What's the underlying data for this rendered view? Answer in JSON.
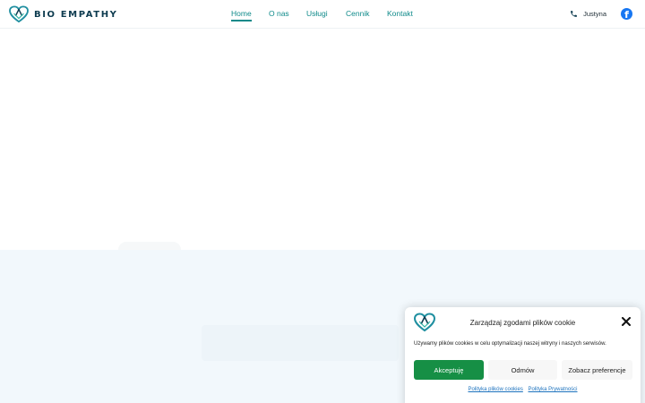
{
  "header": {
    "logo_text": "BIO EMPATHY",
    "nav": [
      {
        "label": "Home",
        "active": true
      },
      {
        "label": "O nas",
        "active": false
      },
      {
        "label": "Usługi",
        "active": false
      },
      {
        "label": "Cennik",
        "active": false
      },
      {
        "label": "Kontakt",
        "active": false
      }
    ],
    "phone_label": "Justyna",
    "facebook_icon": "facebook-icon"
  },
  "cookie_banner": {
    "title": "Zarządzaj zgodami plików cookie",
    "message": "Używamy plików cookies w celu optymalizacji naszej witryny i naszych serwisów.",
    "accept_label": "Akceptuję",
    "deny_label": "Odmów",
    "preferences_label": "Zobacz preferencje",
    "links": [
      "Polityka plików cookies",
      "Polityka Prywatności"
    ]
  },
  "colors": {
    "accent": "#0f8a8a",
    "brand_dark": "#0d3b4f",
    "accept_button": "#168f45",
    "link": "#1e73be",
    "facebook": "#1877f2",
    "section_bg": "#f2f8fc"
  }
}
